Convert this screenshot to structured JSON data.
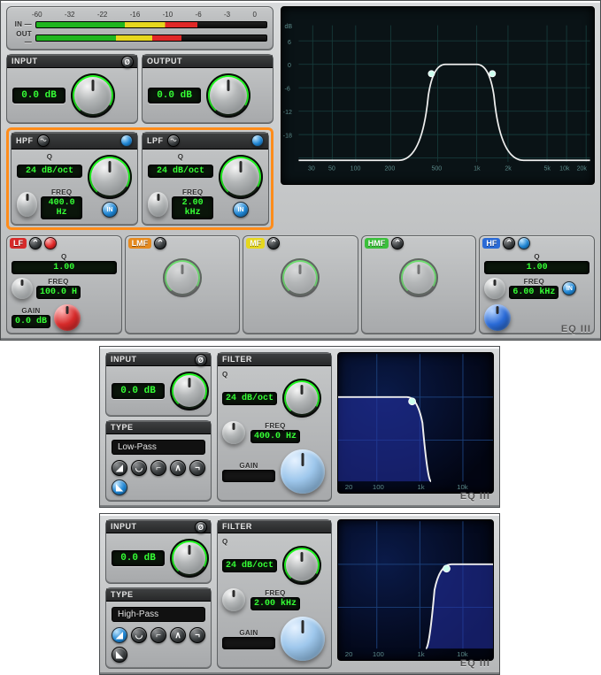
{
  "top": {
    "in_label": "IN —",
    "out_label": "OUT —",
    "scale_ticks": [
      "-60",
      "-32",
      "-22",
      "-16",
      "-10",
      "-6",
      "-3",
      "0"
    ],
    "input_title": "INPUT",
    "output_title": "OUTPUT",
    "input_value": "0.0 dB",
    "output_value": "0.0 dB",
    "hpf": {
      "title": "HPF",
      "slope": "24 dB/oct",
      "freq_label": "FREQ",
      "freq": "400.0 Hz",
      "q_label": "Q"
    },
    "lpf": {
      "title": "LPF",
      "slope": "24 dB/oct",
      "freq_label": "FREQ",
      "freq": "2.00 kHz",
      "q_label": "Q"
    },
    "graph": {
      "y_ticks": [
        "dB",
        "6",
        "0",
        "-6",
        "-12",
        "-18"
      ],
      "x_ticks": [
        "30",
        "50",
        "100",
        "200",
        "500",
        "1k",
        "2k",
        "5k",
        "10k",
        "20k"
      ]
    },
    "bands": [
      {
        "tag": "LF",
        "color": "badge-red",
        "q": "1.00",
        "freq": "100.0 H",
        "gain": "0.0 dB"
      },
      {
        "tag": "LMF",
        "color": "badge-orange",
        "q": "",
        "freq": "",
        "gain": ""
      },
      {
        "tag": "MF",
        "color": "badge-yellow",
        "q": "",
        "freq": "",
        "gain": ""
      },
      {
        "tag": "HMF",
        "color": "badge-green",
        "q": "",
        "freq": "",
        "gain": ""
      },
      {
        "tag": "HF",
        "color": "badge-blue",
        "q": "1.00",
        "freq": "6.00 kHz",
        "gain": ""
      }
    ],
    "q_label": "Q",
    "freq_label": "FREQ",
    "gain_label": "GAIN",
    "in_btn_label": "IN",
    "logo": "EQ III"
  },
  "mid": {
    "input_title": "INPUT",
    "input_value": "0.0 dB",
    "filter_title": "FILTER",
    "q_label": "Q",
    "slope": "24 dB/oct",
    "freq_label": "FREQ",
    "freq": "400.0 Hz",
    "gain_label": "GAIN",
    "type_title": "TYPE",
    "type_value": "Low-Pass",
    "graph_x": [
      "20",
      "100",
      "1k",
      "10k"
    ],
    "logo": "EQ III"
  },
  "bot": {
    "input_title": "INPUT",
    "input_value": "0.0 dB",
    "filter_title": "FILTER",
    "q_label": "Q",
    "slope": "24 dB/oct",
    "freq_label": "FREQ",
    "freq": "2.00 kHz",
    "gain_label": "GAIN",
    "type_title": "TYPE",
    "type_value": "High-Pass",
    "graph_x": [
      "20",
      "100",
      "1k",
      "10k"
    ],
    "logo": "EQ III"
  }
}
